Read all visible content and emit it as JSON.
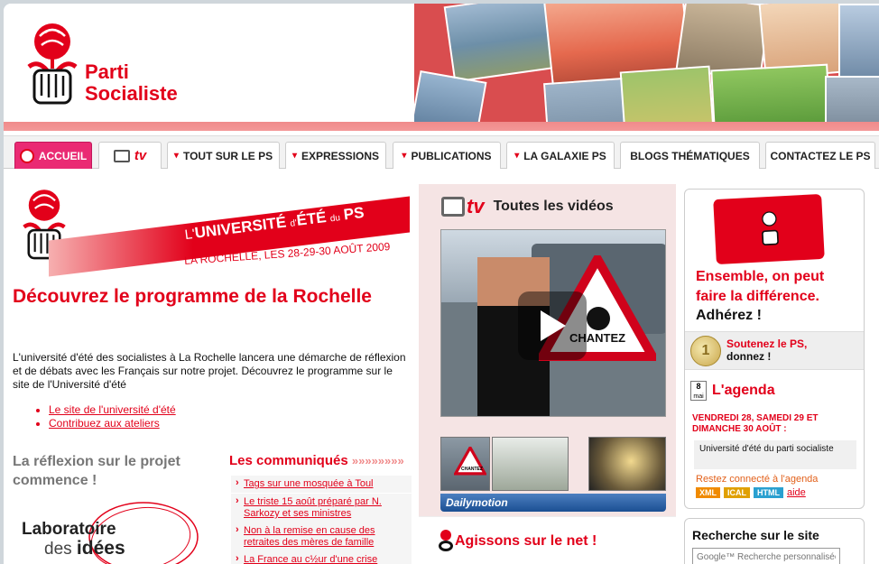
{
  "brand": {
    "line1": "Parti",
    "line2": "Socialiste"
  },
  "nav": {
    "tabs": [
      {
        "label": "ACCUEIL"
      },
      {
        "label": "tv"
      },
      {
        "label": "TOUT SUR LE PS"
      },
      {
        "label": "EXPRESSIONS"
      },
      {
        "label": "PUBLICATIONS"
      },
      {
        "label": "LA GALAXIE PS"
      },
      {
        "label": "BLOGS THÉMATIQUES"
      },
      {
        "label": "CONTACTEZ LE PS"
      }
    ]
  },
  "university": {
    "banner_line1_pre": "L'",
    "banner_line1_main": "UNIVERSITÉ",
    "banner_line1_mid": "d'",
    "banner_line1_ete": "ÉTÉ",
    "banner_line1_du": "du",
    "banner_line1_ps": "PS",
    "banner_line2": "LA ROCHELLE, LES 28-29-30 AOÛT 2009"
  },
  "main": {
    "title": "Découvrez le programme de la Rochelle",
    "intro": "L'université d'été des socialistes à La Rochelle lancera une démarche de réflexion et de débats avec les Français sur notre projet. Découvrez le programme sur le site de l'Université d'été",
    "links": [
      "Le site de l'université d'été",
      "Contribuez aux ateliers"
    ],
    "reflexion_title": "La réflexion sur le projet commence !",
    "labo_line1": "Laboratoire",
    "labo_line2a": "des",
    "labo_line2b": "idées"
  },
  "communiques": {
    "title": "Les communiqués",
    "arrows": "»»»»»»»»",
    "items": [
      "Tags sur une mosquée à Toul",
      "Le triste 15 août préparé par N. Sarkozy et ses ministres",
      "Non à la remise en cause des retraites des mères de famille",
      "La France au c½ur d'une crise"
    ]
  },
  "tv": {
    "logo_text": "tv",
    "all_videos": "Toutes les vidéos",
    "sign_text": "CHANTEZ",
    "thumb_sign": "CHANTEZ",
    "provider": "Dailymotion"
  },
  "agissons": {
    "title": "Agissons sur le net !"
  },
  "join": {
    "slogan": "Ensemble, on peut faire la différence.",
    "cta": "Adhérez !",
    "donate_line1": "Soutenez le PS,",
    "donate_line2": "donnez !",
    "coin_symbol": "1"
  },
  "agenda": {
    "cal_top": "8",
    "cal_bottom": "mai",
    "title": "L'agenda",
    "date": "VENDREDI 28, SAMEDI 29 ET DIMANCHE 30 AOÛT :",
    "event": "Université d'été du parti socialiste",
    "stay_connected": "Restez connecté à l'agenda",
    "badges": [
      "XML",
      "ICAL",
      "HTML"
    ],
    "help": "aide"
  },
  "search": {
    "title": "Recherche sur le site",
    "placeholder": "Google™ Recherche personnalisée"
  },
  "colors": {
    "brand_red": "#e2001a",
    "accent_pink": "#ea2a73",
    "xml_badge": "#f08a00",
    "ical_badge": "#e0a000",
    "html_badge": "#2aa0d0"
  }
}
